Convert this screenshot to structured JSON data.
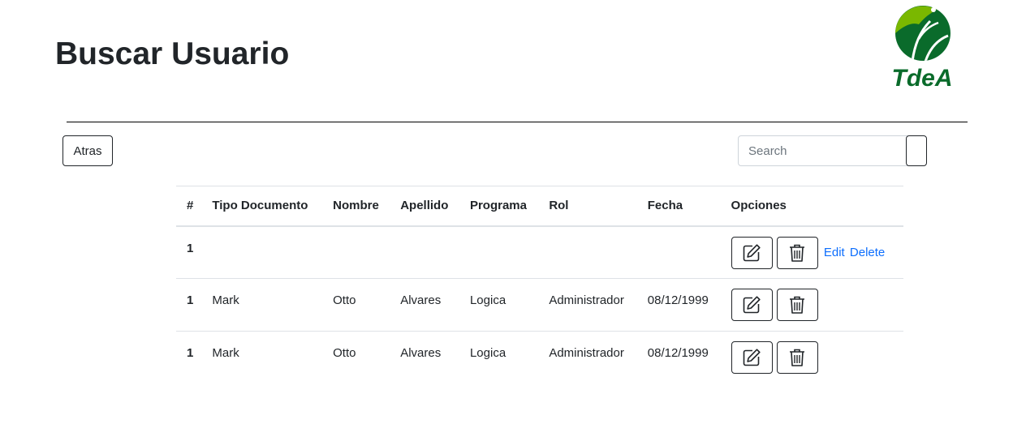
{
  "header": {
    "title": "Buscar Usuario",
    "logo_text": "TdeA"
  },
  "toolbar": {
    "back_label": "Atras",
    "search_placeholder": "Search"
  },
  "table": {
    "columns": [
      "#",
      "Tipo Documento",
      "Nombre",
      "Apellido",
      "Programa",
      "Rol",
      "Fecha",
      "Opciones"
    ],
    "rows": [
      {
        "num": "1",
        "tipo": "",
        "nombre": "",
        "apellido": "",
        "programa": "",
        "rol": "",
        "fecha": "",
        "edit_link": "Edit",
        "delete_link": "Delete"
      },
      {
        "num": "1",
        "tipo": "Mark",
        "nombre": "Otto",
        "apellido": "Alvares",
        "programa": "Logica",
        "rol": "Administrador",
        "fecha": "08/12/1999"
      },
      {
        "num": "1",
        "tipo": "Mark",
        "nombre": "Otto",
        "apellido": "Alvares",
        "programa": "Logica",
        "rol": "Administrador",
        "fecha": "08/12/1999"
      }
    ]
  },
  "colors": {
    "logo_green_light": "#7ab800",
    "logo_green_dark": "#0a6b2b",
    "link": "#0d6efd",
    "text": "#212529"
  },
  "icons": {
    "edit": "pencil-square-icon",
    "delete": "trash-icon"
  }
}
